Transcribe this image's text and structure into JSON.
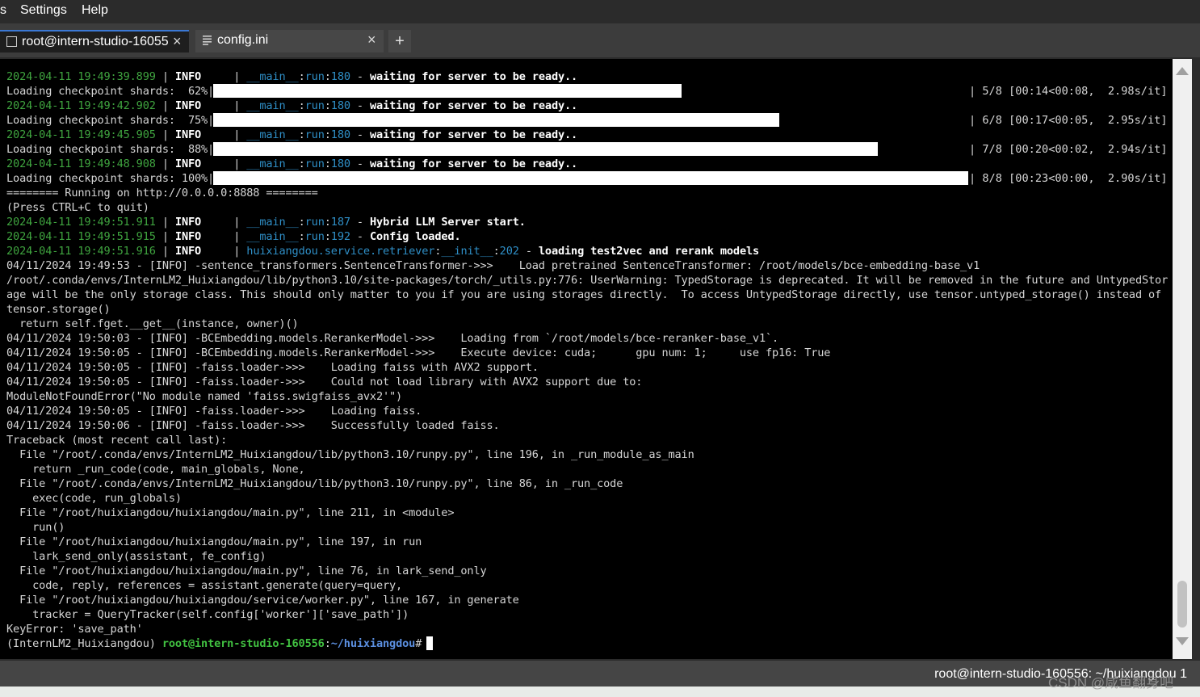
{
  "menu": {
    "items": [
      "s",
      "Settings",
      "Help"
    ]
  },
  "tabs": [
    {
      "label": "root@intern-studio-16055",
      "close": "×",
      "active": true
    },
    {
      "label": "config.ini",
      "close": "×",
      "active": false
    }
  ],
  "new_tab": "+",
  "terminal": {
    "lines": [
      [
        {
          "t": "2024-04-11 19:49:39.899",
          "c": "ts"
        },
        {
          "t": " | "
        },
        {
          "t": "INFO",
          "c": "bold"
        },
        {
          "t": "     | "
        },
        {
          "t": "__main__",
          "c": "mod"
        },
        {
          "t": ":"
        },
        {
          "t": "run",
          "c": "mod"
        },
        {
          "t": ":"
        },
        {
          "t": "180",
          "c": "mod"
        },
        {
          "t": " - "
        },
        {
          "t": "waiting for server to be ready..",
          "c": "bold"
        }
      ],
      [
        {
          "t": "Loading checkpoint shards:  62%|"
        }
      ],
      [
        {
          "t": "2024-04-11 19:49:42.902",
          "c": "ts"
        },
        {
          "t": " | "
        },
        {
          "t": "INFO",
          "c": "bold"
        },
        {
          "t": "     | "
        },
        {
          "t": "__main__",
          "c": "mod"
        },
        {
          "t": ":"
        },
        {
          "t": "run",
          "c": "mod"
        },
        {
          "t": ":"
        },
        {
          "t": "180",
          "c": "mod"
        },
        {
          "t": " - "
        },
        {
          "t": "waiting for server to be ready..",
          "c": "bold"
        }
      ],
      [
        {
          "t": "Loading checkpoint shards:  75%|"
        }
      ],
      [
        {
          "t": "2024-04-11 19:49:45.905",
          "c": "ts"
        },
        {
          "t": " | "
        },
        {
          "t": "INFO",
          "c": "bold"
        },
        {
          "t": "     | "
        },
        {
          "t": "__main__",
          "c": "mod"
        },
        {
          "t": ":"
        },
        {
          "t": "run",
          "c": "mod"
        },
        {
          "t": ":"
        },
        {
          "t": "180",
          "c": "mod"
        },
        {
          "t": " - "
        },
        {
          "t": "waiting for server to be ready..",
          "c": "bold"
        }
      ],
      [
        {
          "t": "Loading checkpoint shards:  88%|"
        }
      ],
      [
        {
          "t": "2024-04-11 19:49:48.908",
          "c": "ts"
        },
        {
          "t": " | "
        },
        {
          "t": "INFO",
          "c": "bold"
        },
        {
          "t": "     | "
        },
        {
          "t": "__main__",
          "c": "mod"
        },
        {
          "t": ":"
        },
        {
          "t": "run",
          "c": "mod"
        },
        {
          "t": ":"
        },
        {
          "t": "180",
          "c": "mod"
        },
        {
          "t": " - "
        },
        {
          "t": "waiting for server to be ready..",
          "c": "bold"
        }
      ],
      [
        {
          "t": "Loading checkpoint shards: 100%|"
        }
      ],
      [
        {
          "t": "======== Running on http://0.0.0.0:8888 ========"
        }
      ],
      [
        {
          "t": "(Press CTRL+C to quit)"
        }
      ],
      [
        {
          "t": "2024-04-11 19:49:51.911",
          "c": "ts"
        },
        {
          "t": " | "
        },
        {
          "t": "INFO",
          "c": "bold"
        },
        {
          "t": "     | "
        },
        {
          "t": "__main__",
          "c": "mod"
        },
        {
          "t": ":"
        },
        {
          "t": "run",
          "c": "mod"
        },
        {
          "t": ":"
        },
        {
          "t": "187",
          "c": "mod"
        },
        {
          "t": " - "
        },
        {
          "t": "Hybrid LLM Server start.",
          "c": "bold"
        }
      ],
      [
        {
          "t": "2024-04-11 19:49:51.915",
          "c": "ts"
        },
        {
          "t": " | "
        },
        {
          "t": "INFO",
          "c": "bold"
        },
        {
          "t": "     | "
        },
        {
          "t": "__main__",
          "c": "mod"
        },
        {
          "t": ":"
        },
        {
          "t": "run",
          "c": "mod"
        },
        {
          "t": ":"
        },
        {
          "t": "192",
          "c": "mod"
        },
        {
          "t": " - "
        },
        {
          "t": "Config loaded.",
          "c": "bold"
        }
      ],
      [
        {
          "t": "2024-04-11 19:49:51.916",
          "c": "ts"
        },
        {
          "t": " | "
        },
        {
          "t": "INFO",
          "c": "bold"
        },
        {
          "t": "     | "
        },
        {
          "t": "huixiangdou.service.retriever",
          "c": "mod"
        },
        {
          "t": ":"
        },
        {
          "t": "__init__",
          "c": "mod"
        },
        {
          "t": ":"
        },
        {
          "t": "202",
          "c": "mod"
        },
        {
          "t": " - "
        },
        {
          "t": "loading test2vec and rerank models",
          "c": "bold"
        }
      ],
      [
        {
          "t": "04/11/2024 19:49:53 - [INFO] -sentence_transformers.SentenceTransformer->>>    Load pretrained SentenceTransformer: /root/models/bce-embedding-base_v1"
        }
      ],
      [
        {
          "t": "/root/.conda/envs/InternLM2_Huixiangdou/lib/python3.10/site-packages/torch/_utils.py:776: UserWarning: TypedStorage is deprecated. It will be removed in the future and UntypedStor"
        }
      ],
      [
        {
          "t": "age will be the only storage class. This should only matter to you if you are using storages directly.  To access UntypedStorage directly, use tensor.untyped_storage() instead of"
        }
      ],
      [
        {
          "t": "tensor.storage()"
        }
      ],
      [
        {
          "t": "  return self.fget.__get__(instance, owner)()"
        }
      ],
      [
        {
          "t": "04/11/2024 19:50:03 - [INFO] -BCEmbedding.models.RerankerModel->>>    Loading from `/root/models/bce-reranker-base_v1`."
        }
      ],
      [
        {
          "t": "04/11/2024 19:50:05 - [INFO] -BCEmbedding.models.RerankerModel->>>    Execute device: cuda;      gpu num: 1;     use fp16: True"
        }
      ],
      [
        {
          "t": "04/11/2024 19:50:05 - [INFO] -faiss.loader->>>    Loading faiss with AVX2 support."
        }
      ],
      [
        {
          "t": "04/11/2024 19:50:05 - [INFO] -faiss.loader->>>    Could not load library with AVX2 support due to:"
        }
      ],
      [
        {
          "t": "ModuleNotFoundError(\"No module named 'faiss.swigfaiss_avx2'\")"
        }
      ],
      [
        {
          "t": "04/11/2024 19:50:05 - [INFO] -faiss.loader->>>    Loading faiss."
        }
      ],
      [
        {
          "t": "04/11/2024 19:50:06 - [INFO] -faiss.loader->>>    Successfully loaded faiss."
        }
      ],
      [
        {
          "t": "Traceback (most recent call last):"
        }
      ],
      [
        {
          "t": "  File \"/root/.conda/envs/InternLM2_Huixiangdou/lib/python3.10/runpy.py\", line 196, in _run_module_as_main"
        }
      ],
      [
        {
          "t": "    return _run_code(code, main_globals, None,"
        }
      ],
      [
        {
          "t": "  File \"/root/.conda/envs/InternLM2_Huixiangdou/lib/python3.10/runpy.py\", line 86, in _run_code"
        }
      ],
      [
        {
          "t": "    exec(code, run_globals)"
        }
      ],
      [
        {
          "t": "  File \"/root/huixiangdou/huixiangdou/main.py\", line 211, in <module>"
        }
      ],
      [
        {
          "t": "    run()"
        }
      ],
      [
        {
          "t": "  File \"/root/huixiangdou/huixiangdou/main.py\", line 197, in run"
        }
      ],
      [
        {
          "t": "    lark_send_only(assistant, fe_config)"
        }
      ],
      [
        {
          "t": "  File \"/root/huixiangdou/huixiangdou/main.py\", line 76, in lark_send_only"
        }
      ],
      [
        {
          "t": "    code, reply, references = assistant.generate(query=query,"
        }
      ],
      [
        {
          "t": "  File \"/root/huixiangdou/huixiangdou/service/worker.py\", line 167, in generate"
        }
      ],
      [
        {
          "t": "    tracker = QueryTracker(self.config['worker']['save_path'])"
        }
      ],
      [
        {
          "t": "KeyError: 'save_path'"
        }
      ],
      [
        {
          "t": "(InternLM2_Huixiangdou) "
        },
        {
          "t": "root@intern-studio-160556",
          "c": "prompt-user"
        },
        {
          "t": ":"
        },
        {
          "t": "~/huixiangdou",
          "c": "prompt-path"
        },
        {
          "t": "# "
        }
      ]
    ],
    "progress": [
      {
        "line": 1,
        "fraction": 0.62,
        "stats": "| 5/8 [00:14<00:08,  2.98s/it]"
      },
      {
        "line": 3,
        "fraction": 0.75,
        "stats": "| 6/8 [00:17<00:05,  2.95s/it]"
      },
      {
        "line": 5,
        "fraction": 0.88,
        "stats": "| 7/8 [00:20<00:02,  2.94s/it]"
      },
      {
        "line": 7,
        "fraction": 1.0,
        "stats": "| 8/8 [00:23<00:00,  2.90s/it]"
      }
    ]
  },
  "status": {
    "text": "root@intern-studio-160556: ~/huixiangdou   1"
  },
  "watermark": "CSDN @咸鱼翻身吧"
}
